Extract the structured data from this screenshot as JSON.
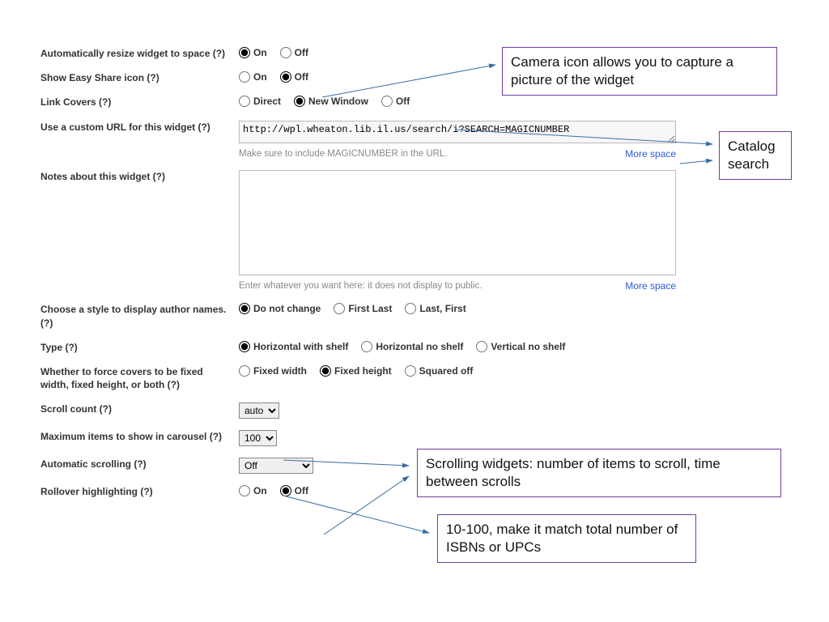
{
  "rows": {
    "resize": {
      "label": "Automatically resize widget to space (?)",
      "options": [
        "On",
        "Off"
      ],
      "selected": "On"
    },
    "easyshare": {
      "label": "Show Easy Share icon (?)",
      "options": [
        "On",
        "Off"
      ],
      "selected": "Off"
    },
    "linkcovers": {
      "label": "Link Covers (?)",
      "options": [
        "Direct",
        "New Window",
        "Off"
      ],
      "selected": "New Window"
    },
    "customurl": {
      "label": "Use a custom URL for this widget (?)",
      "value": "http://wpl.wheaton.lib.il.us/search/i?SEARCH=MAGICNUMBER",
      "hint": "Make sure to include MAGICNUMBER in the URL.",
      "more": "More space"
    },
    "notes": {
      "label": "Notes about this widget (?)",
      "value": "",
      "hint": "Enter whatever you want here: it does not display to public.",
      "more": "More space"
    },
    "authorstyle": {
      "label": "Choose a style to display author names. (?)",
      "options": [
        "Do not change",
        "First Last",
        "Last, First"
      ],
      "selected": "Do not change"
    },
    "type": {
      "label": "Type (?)",
      "options": [
        "Horizontal with shelf",
        "Horizontal no shelf",
        "Vertical no shelf"
      ],
      "selected": "Horizontal with shelf"
    },
    "forcecover": {
      "label": "Whether to force covers to be fixed width, fixed height, or both (?)",
      "options": [
        "Fixed width",
        "Fixed height",
        "Squared off"
      ],
      "selected": "Fixed height"
    },
    "scrollcount": {
      "label": "Scroll count (?)",
      "value": "auto"
    },
    "maxitems": {
      "label": "Maximum items to show in carousel (?)",
      "value": "100"
    },
    "autoscroll": {
      "label": "Automatic scrolling (?)",
      "value": "Off"
    },
    "rollover": {
      "label": "Rollover highlighting (?)",
      "options": [
        "On",
        "Off"
      ],
      "selected": "Off"
    }
  },
  "callouts": {
    "camera": "Camera icon allows you to capture a picture of the widget",
    "catalog": "Catalog search",
    "scrolling": "Scrolling widgets: number of items to scroll, time between scrolls",
    "isbn": "10-100, make it match total number of ISBNs or UPCs"
  }
}
